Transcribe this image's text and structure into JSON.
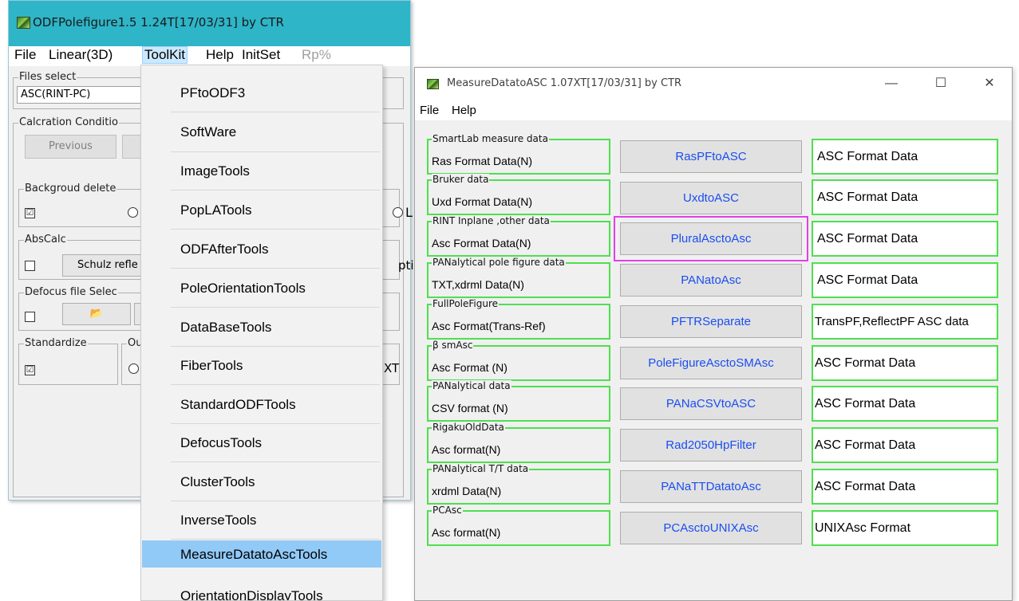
{
  "main_window": {
    "title": "ODFPolefigure1.5 1.24T[17/03/31] by CTR",
    "menu": [
      "File",
      "Linear(3D)",
      "ToolKit",
      "Help",
      "InitSet",
      "Rp%"
    ],
    "files_select_label": "Files select",
    "files_select_value": "ASC(RINT-PC)",
    "calc_label": "Calcration Conditio",
    "previous_button": "Previous",
    "bg_delete_label": "Backgroud delete",
    "abscalc_label": "AbsCalc",
    "schulz_button": "Schulz refle",
    "option_text": "ptior",
    "defocus_label": "Defocus file Selec",
    "standardize_label": "Standardize",
    "out_label": "Ou",
    "xt_text": "XT",
    "radio_l": "L",
    "check_mark": "☑",
    "folder_icon": "📂"
  },
  "dropdown": {
    "items": [
      "PFtoODF3",
      "SoftWare",
      "ImageTools",
      "PopLATools",
      "ODFAfterTools",
      "PoleOrientationTools",
      "DataBaseTools",
      "FiberTools",
      "StandardODFTools",
      "DefocusTools",
      "ClusterTools",
      "InverseTools",
      "MeasureDatatoAscTools",
      "OrientationDisplayTools"
    ],
    "highlighted": "MeasureDatatoAscTools"
  },
  "measure_window": {
    "title": "MeasureDatatoASC 1.07XT[17/03/31] by CTR",
    "menu": [
      "File",
      "Help"
    ],
    "controls": {
      "minimize": "—",
      "maximize": "☐",
      "close": "✕"
    },
    "rows": [
      {
        "group": "SmartLab measure data",
        "input": "Ras Format Data(N)",
        "button": "RasPFtoASC",
        "output": "ASC Format Data"
      },
      {
        "group": "Bruker data",
        "input": "Uxd Format Data(N)",
        "button": "UxdtoASC",
        "output": "ASC Format Data"
      },
      {
        "group": "RINT Inplane ,other data",
        "input": "Asc Format Data(N)",
        "button": "PluralAsctoAsc",
        "output": "ASC Format Data"
      },
      {
        "group": "PANalytical pole figure data",
        "input": "TXT,xdrml Data(N)",
        "button": "PANatoAsc",
        "output": "ASC Format Data"
      },
      {
        "group": "FullPoleFigure",
        "input": "Asc Format(Trans-Ref)",
        "button": "PFTRSeparate",
        "output": "TransPF,ReflectPF ASC data"
      },
      {
        "group": "β smAsc",
        "input": "Asc Format (N)",
        "button": "PoleFigureAsctoSMAsc",
        "output": "ASC Format Data"
      },
      {
        "group": "PANalytical data",
        "input": "CSV format (N)",
        "button": "PANaCSVtoASC",
        "output": "ASC Format Data"
      },
      {
        "group": "RigakuOldData",
        "input": "Asc format(N)",
        "button": "Rad2050HpFilter",
        "output": "ASC Format Data"
      },
      {
        "group": "PANalytical T/T data",
        "input": "xrdml Data(N)",
        "button": "PANaTTDatatoAsc",
        "output": "ASC Format Data"
      },
      {
        "group": "PCAsc",
        "input": "Asc format(N)",
        "button": "PCAsctoUNIXAsc",
        "output": "UNIXAsc Format"
      }
    ],
    "selected_button": "PluralAsctoAsc"
  },
  "colors": {
    "main_title_bar": "#2eb5c8",
    "group_border": "#4ee04e",
    "button_text": "#1a4ef0",
    "selection_outline": "#e040e8",
    "menu_highlight": "#91c9f7"
  }
}
